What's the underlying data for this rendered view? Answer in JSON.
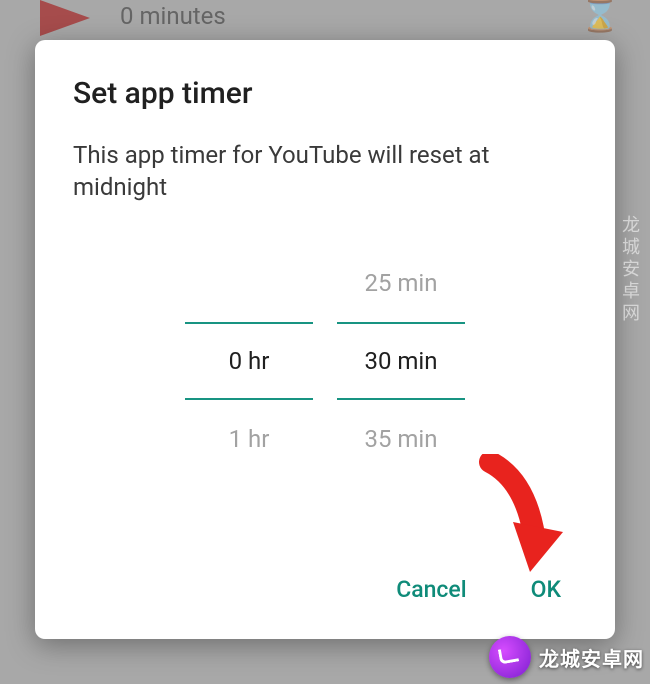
{
  "background": {
    "subtitle": "0 minutes"
  },
  "dialog": {
    "title": "Set app timer",
    "body": "This app timer for YouTube will reset at midnight",
    "picker": {
      "hour_above": "",
      "hour_selected": "0 hr",
      "hour_below": "1 hr",
      "min_above": "25 min",
      "min_selected": "30 min",
      "min_below": "35 min"
    },
    "buttons": {
      "cancel": "Cancel",
      "ok": "OK"
    }
  },
  "watermark": {
    "side": "龙城安卓网",
    "bottom": "龙城安卓网"
  }
}
